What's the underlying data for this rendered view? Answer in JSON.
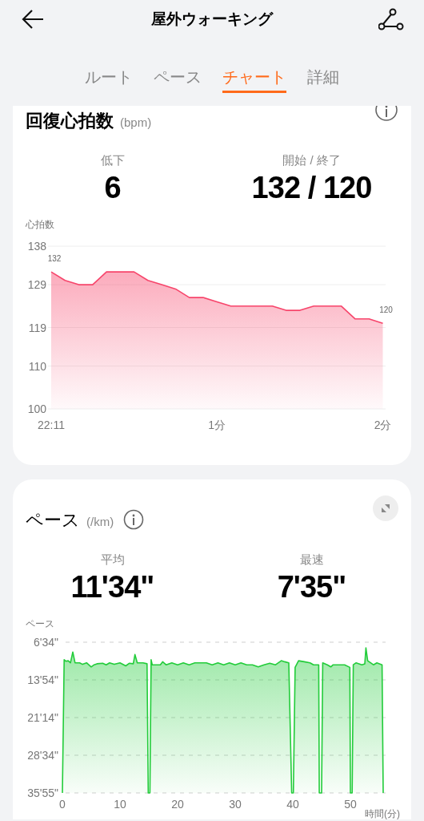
{
  "header": {
    "title": "屋外ウォーキング"
  },
  "tabs": [
    {
      "label": "ルート",
      "selected": false
    },
    {
      "label": "ペース",
      "selected": false
    },
    {
      "label": "チャート",
      "selected": true
    },
    {
      "label": "詳細",
      "selected": false
    }
  ],
  "cards": [
    {
      "title": "回復心拍数",
      "unit": "(bpm)",
      "expand_button": false,
      "stats": [
        {
          "label": "低下",
          "value": "6"
        },
        {
          "label": "開始 / 終了",
          "value": "132 / 120"
        }
      ],
      "chart_data": {
        "type": "area",
        "ylabel": "心拍数",
        "color": "#f7456b",
        "grid": true,
        "categories": [
          "22:11",
          null,
          null,
          null,
          null,
          null,
          null,
          null,
          null,
          null,
          null,
          null,
          "1分",
          null,
          null,
          null,
          null,
          null,
          null,
          null,
          null,
          null,
          null,
          null,
          "2分"
        ],
        "values": [
          132,
          130,
          129,
          129,
          132,
          132,
          132,
          130,
          129,
          128,
          126,
          126,
          125,
          124,
          124,
          124,
          124,
          123,
          123,
          124,
          124,
          124,
          121,
          121,
          120
        ],
        "ylim": [
          100,
          138
        ],
        "yticks": [
          100,
          110,
          119,
          129,
          138
        ],
        "annotations": [
          {
            "x": "22:11",
            "y": 132,
            "text": "132"
          },
          {
            "x": "2分",
            "y": 120,
            "text": "120"
          }
        ]
      }
    },
    {
      "title": "ペース",
      "unit": "(/km)",
      "expand_button": true,
      "stats": [
        {
          "label": "平均",
          "value": "11'34\""
        },
        {
          "label": "最速",
          "value": "7'35\""
        }
      ],
      "plot": {
        "y_title": "ペース",
        "x_title": "時間(分)",
        "y_labels": [
          "6'34\"",
          "13'54\"",
          "21'14\"",
          "28'34\"",
          "35'55\""
        ],
        "x_labels": [
          "0",
          "10",
          "20",
          "30",
          "40",
          "50"
        ]
      }
    }
  ]
}
